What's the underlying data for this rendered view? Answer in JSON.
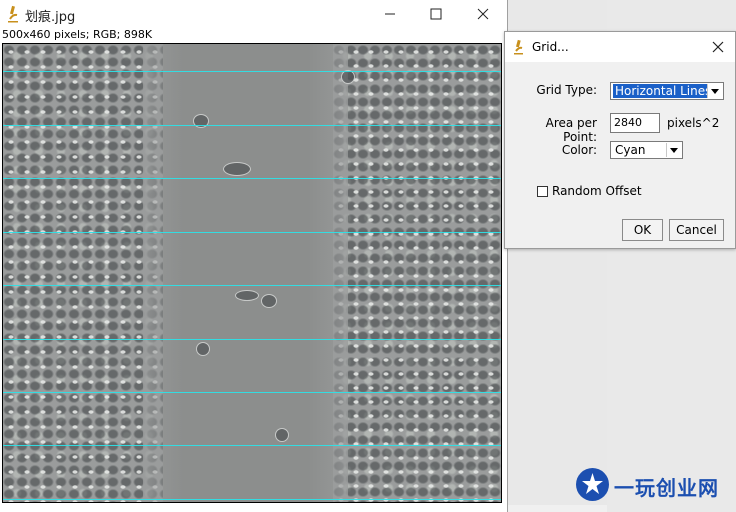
{
  "image_window": {
    "title": "划痕.jpg",
    "info": "500x460 pixels; RGB; 898K",
    "grid_line_color": "#2ee0e6"
  },
  "grid_dialog": {
    "title": "Grid...",
    "grid_type_label": "Grid Type:",
    "grid_type_value": "Horizontal Lines",
    "area_label": "Area per Point:",
    "area_value": "2840",
    "area_unit": "pixels^2",
    "color_label": "Color:",
    "color_value": "Cyan",
    "random_offset_label": "Random Offset",
    "random_offset_checked": false,
    "ok_label": "OK",
    "cancel_label": "Cancel"
  },
  "watermark": {
    "text": "一玩创业网",
    "color": "#1c4fb0"
  }
}
